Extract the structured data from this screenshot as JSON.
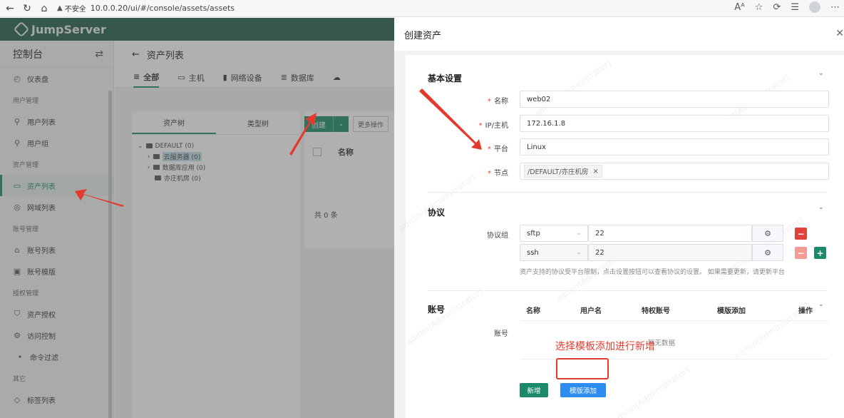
{
  "browser": {
    "security_label": "不安全",
    "url": "10.0.0.20/ui/#/console/assets/assets"
  },
  "app": {
    "logo_text": "JumpServer",
    "sidebar": {
      "title": "控制台",
      "items": [
        {
          "type": "item",
          "label": "仪表盘",
          "icon": "dashboard-icon",
          "glyph": "◴"
        },
        {
          "type": "group",
          "label": "用户管理"
        },
        {
          "type": "item",
          "label": "用户列表",
          "icon": "user-icon",
          "glyph": "⚲"
        },
        {
          "type": "item",
          "label": "用户组",
          "icon": "user-group-icon",
          "glyph": "⚲"
        },
        {
          "type": "group",
          "label": "资产管理"
        },
        {
          "type": "item",
          "label": "资产列表",
          "icon": "monitor-icon",
          "glyph": "▭",
          "active": true
        },
        {
          "type": "item",
          "label": "网域列表",
          "icon": "domain-icon",
          "glyph": "◎"
        },
        {
          "type": "group",
          "label": "账号管理"
        },
        {
          "type": "item",
          "label": "账号列表",
          "icon": "lock-icon",
          "glyph": "⌂"
        },
        {
          "type": "item",
          "label": "账号模版",
          "icon": "template-icon",
          "glyph": "▣"
        },
        {
          "type": "group",
          "label": "授权管理"
        },
        {
          "type": "item",
          "label": "资产授权",
          "icon": "shield-icon",
          "glyph": "⛉"
        },
        {
          "type": "item",
          "label": "访问控制",
          "icon": "access-control-icon",
          "glyph": "⚙"
        },
        {
          "type": "sub",
          "label": "命令过滤"
        },
        {
          "type": "group",
          "label": "其它"
        },
        {
          "type": "item",
          "label": "标签列表",
          "icon": "tag-icon",
          "glyph": "◇"
        }
      ]
    },
    "page_title": "资产列表",
    "tabs": [
      "全部",
      "主机",
      "网络设备",
      "数据库"
    ],
    "tree_tabs": [
      "资产树",
      "类型树"
    ],
    "tree": {
      "root": "DEFAULT (0)",
      "children": [
        "云服务器 (0)",
        "数据库应用 (0)",
        "亦庄机房 (0)"
      ]
    },
    "create_label": "创建",
    "more_label": "更多操作",
    "col_name": "名称",
    "total": "共 0 条"
  },
  "drawer": {
    "title": "创建资产",
    "basic": {
      "title": "基本设置",
      "fields": [
        {
          "label": "名称",
          "value": "web02"
        },
        {
          "label": "IP/主机",
          "value": "172.16.1.8"
        },
        {
          "label": "平台",
          "value": "Linux"
        },
        {
          "label": "节点",
          "value": "/DEFAULT/亦庄机房"
        }
      ]
    },
    "protocol": {
      "title": "协议",
      "group_label": "协议组",
      "rows": [
        {
          "name": "sftp",
          "port": "22"
        },
        {
          "name": "ssh",
          "port": "22"
        }
      ],
      "hint": "资产支持的协议受平台限制，点击设置按钮可以查看协议的设置。 如果需要更新，请更新平台"
    },
    "account": {
      "title": "账号",
      "label": "账号",
      "columns": [
        "名称",
        "用户名",
        "特权账号",
        "模版添加",
        "操作"
      ],
      "empty": "暂无数据",
      "add_label": "新增",
      "template_add_label": "模版添加"
    },
    "annotation": "选择模板添加进行新增",
    "watermark": "admin(Administrator)"
  },
  "colors": {
    "brand": "#1a8a6b",
    "danger": "#e0413a",
    "annotation": "#e23b2e",
    "primary": "#2d8cf0"
  }
}
